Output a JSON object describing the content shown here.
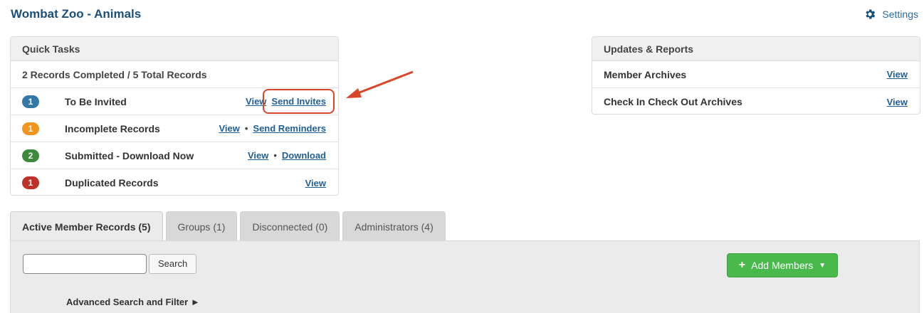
{
  "header": {
    "title": "Wombat Zoo - Animals",
    "settings_label": "Settings",
    "settings_icon": "gear-icon"
  },
  "quick_tasks": {
    "title": "Quick Tasks",
    "summary": "2 Records Completed / 5 Total Records",
    "items": [
      {
        "count": "1",
        "label": "To Be Invited",
        "color": "#3377a6",
        "actions": [
          "View",
          "Send Invites"
        ]
      },
      {
        "count": "1",
        "label": "Incomplete Records",
        "color": "#f0961e",
        "actions": [
          "View",
          "Send Reminders"
        ]
      },
      {
        "count": "2",
        "label": "Submitted - Download Now",
        "color": "#3c8a3c",
        "actions": [
          "View",
          "Download"
        ]
      },
      {
        "count": "1",
        "label": "Duplicated Records",
        "color": "#c0302b",
        "actions": [
          "View"
        ]
      }
    ]
  },
  "updates": {
    "title": "Updates & Reports",
    "items": [
      {
        "label": "Member Archives",
        "action": "View"
      },
      {
        "label": "Check In Check Out Archives",
        "action": "View"
      }
    ]
  },
  "tabs": [
    {
      "label": "Active Member Records (5)",
      "active": true
    },
    {
      "label": "Groups (1)",
      "active": false
    },
    {
      "label": "Disconnected (0)",
      "active": false
    },
    {
      "label": "Administrators (4)",
      "active": false
    }
  ],
  "toolbar": {
    "search_value": "",
    "search_button": "Search",
    "add_members": "Add Members",
    "advanced_search": "Advanced Search and Filter ►"
  },
  "colors": {
    "title": "#1a4f7a",
    "link": "#1f5f95",
    "add_button": "#48b94a",
    "annotation": "#d9472b"
  }
}
